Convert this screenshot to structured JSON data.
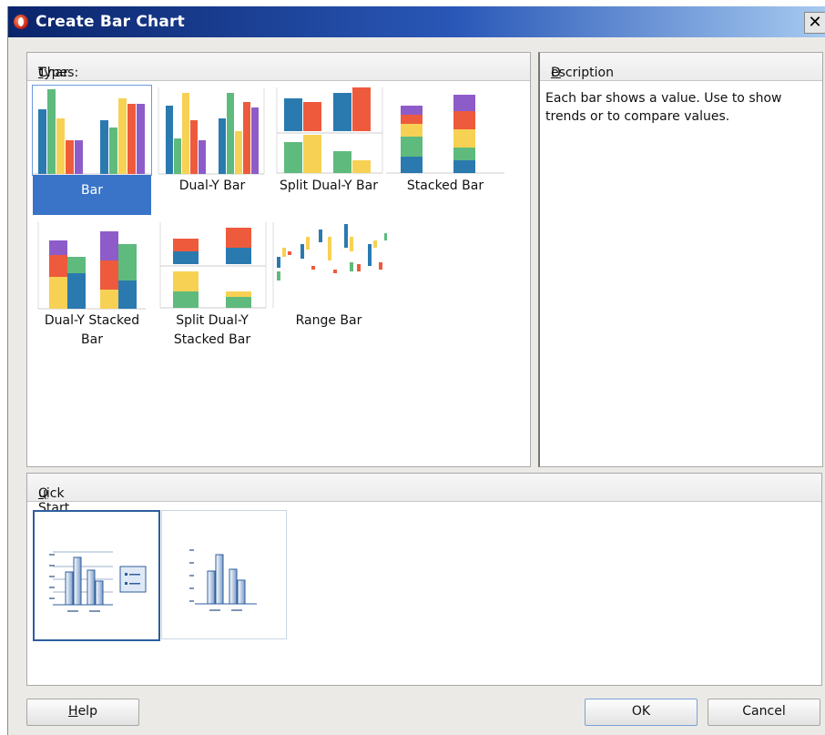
{
  "window": {
    "title": "Create  Bar Chart",
    "close_glyph": "✕"
  },
  "chart_types": {
    "header_prefix": "Char",
    "header_mnemonic": "t",
    "header_suffix": " Types:",
    "items": [
      {
        "id": "bar",
        "label": "Bar",
        "selected": true
      },
      {
        "id": "dual-y-bar",
        "label": "Dual-Y Bar",
        "selected": false
      },
      {
        "id": "split-dual-y-bar",
        "label": "Split Dual-Y Bar",
        "selected": false
      },
      {
        "id": "stacked-bar",
        "label": "Stacked Bar",
        "selected": false
      },
      {
        "id": "dual-y-stacked-bar",
        "label": "Dual-Y Stacked Bar",
        "selected": false
      },
      {
        "id": "split-dual-y-stacked-bar",
        "label": "Split Dual-Y Stacked Bar",
        "selected": false
      },
      {
        "id": "range-bar",
        "label": "Range Bar",
        "selected": false
      }
    ]
  },
  "description": {
    "header_mnemonic": "D",
    "header_rest": "escription",
    "text": "Each bar shows a value. Use to show trends or to compare values."
  },
  "quick_start": {
    "header_mnemonic": "Q",
    "header_rest": "uick Start Layouts:",
    "layouts": [
      {
        "id": "with-legend",
        "selected": true
      },
      {
        "id": "no-legend",
        "selected": false
      }
    ]
  },
  "buttons": {
    "help_mnemonic": "H",
    "help_rest": "elp",
    "ok": "OK",
    "cancel": "Cancel"
  },
  "colors": {
    "blue": "#2a7ab0",
    "green": "#5fba7d",
    "yellow": "#f7d154",
    "orange": "#ee5a3c",
    "purple": "#8e5cc9",
    "selection": "#3a74c8"
  }
}
